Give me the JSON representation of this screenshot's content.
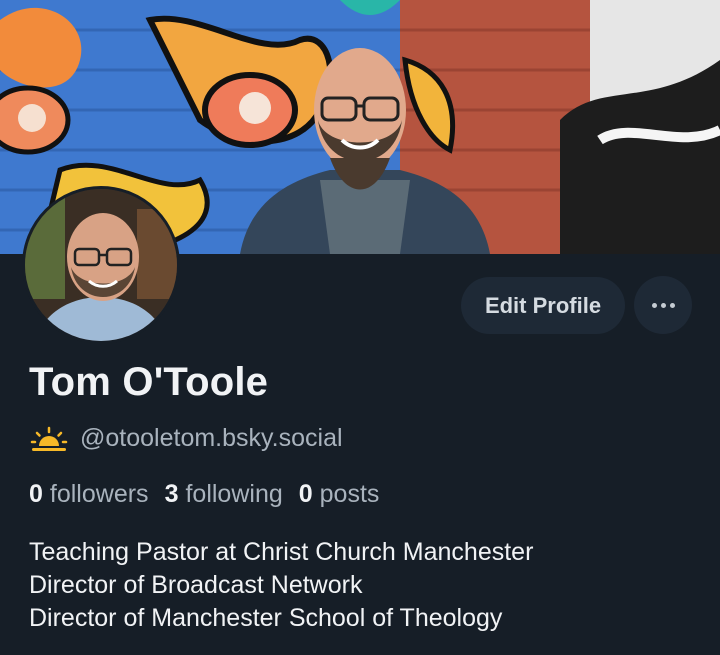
{
  "profile": {
    "display_name": "Tom O'Toole",
    "handle": "@otooletom.bsky.social",
    "handle_emoji_icon": "sunrise-icon",
    "stats": {
      "followers_count": "0",
      "followers_label": "followers",
      "following_count": "3",
      "following_label": "following",
      "posts_count": "0",
      "posts_label": "posts"
    },
    "bio_lines": [
      "Teaching Pastor at Christ Church Manchester",
      "Director of Broadcast Network",
      "Director of Manchester School of Theology"
    ]
  },
  "actions": {
    "edit_profile_label": "Edit Profile",
    "more_icon": "ellipsis-icon"
  },
  "colors": {
    "background": "#161e27",
    "button_bg": "#1e2936",
    "primary_text": "#f1f3f5",
    "secondary_text": "#a9b3bd"
  }
}
